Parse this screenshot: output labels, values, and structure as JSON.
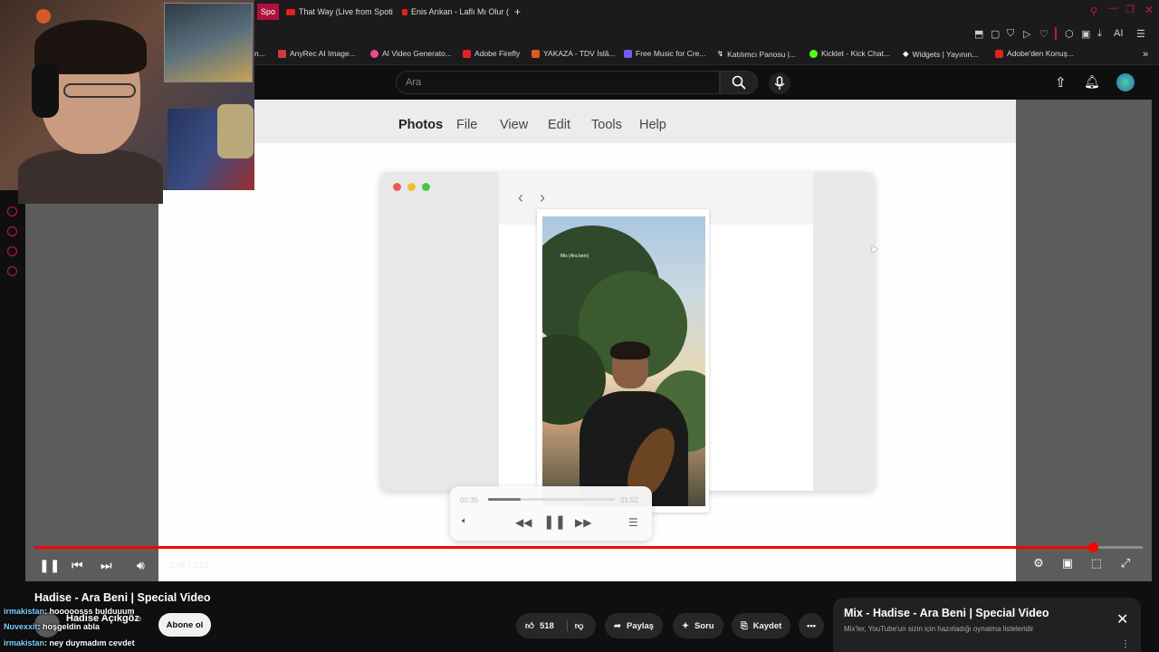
{
  "browser": {
    "tabs": [
      {
        "label": "Spo",
        "active": true
      },
      {
        "label": "That Way (Live from Spoti",
        "active": false
      },
      {
        "label": "Enis Arıkan - Laflı Mı Olur (",
        "active": false
      }
    ],
    "new_tab": "+",
    "bookmarks": [
      {
        "label": "n...",
        "color": ""
      },
      {
        "label": "AnyRec AI Image...",
        "color": "#d23b3b"
      },
      {
        "label": "AI Video Generato...",
        "color": "#e84a8a"
      },
      {
        "label": "Adobe Firefly",
        "color": "#e0221f"
      },
      {
        "label": "YAKAZA - TDV İslâ...",
        "color": "#e0591f"
      },
      {
        "label": "Free Music for Cre...",
        "color": "#7a5af5"
      },
      {
        "label": "Katılımcı Panosu |...",
        "color": "#ffffff"
      },
      {
        "label": "Kicklet - Kick Chat...",
        "color": "#53fc18"
      },
      {
        "label": "Widgets | Yayının...",
        "color": "#ffffff"
      },
      {
        "label": "Adobe'den Konuş...",
        "color": "#e0221f"
      }
    ],
    "toolbar_ai": "AI"
  },
  "youtube": {
    "search_placeholder": "Ara",
    "video": {
      "title": "Hadise - Ara Beni | Special Video",
      "channel": "Hadise Açıkgöz",
      "time_current": "1:48",
      "time_sep": "/",
      "time_total": "1:53",
      "progress": 0.955,
      "likes": "518",
      "subscribe_label": "Abone ol",
      "share_label": "Paylaş",
      "ask_label": "Soru",
      "save_label": "Kaydet"
    },
    "mix": {
      "title": "Mix - Hadise - Ara Beni | Special Video",
      "subtitle": "Mix'ler, YouTube'un sizin için hazırladığı oynatma listeleridir"
    }
  },
  "video_frame": {
    "menu": [
      "Photos",
      "File",
      "View",
      "Edit",
      "Tools",
      "Help"
    ],
    "photo_caption": "Mix (Ara beni)",
    "player_time_current": "00:35",
    "player_time_total": "01:52",
    "player_progress": 0.26
  },
  "overlay_chat": [
    {
      "user": "irmakistan",
      "message": ": hooooosss bulduuum"
    },
    {
      "user": "Nuvexxit",
      "message": ": hoşgeldin abla"
    },
    {
      "user": "irmakistan",
      "message": ": ney duymadım cevdet"
    }
  ],
  "colors": {
    "accent_red": "#ff0000",
    "tab_active": "#b0103a",
    "bg": "#0f0f0f"
  }
}
